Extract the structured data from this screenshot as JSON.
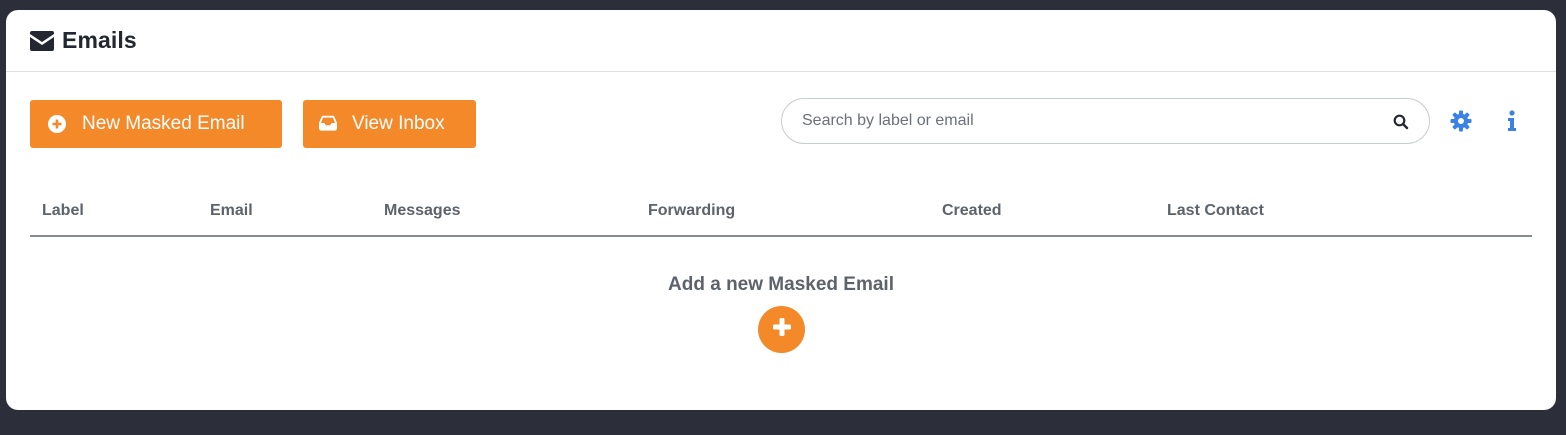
{
  "header": {
    "icon": "envelope-icon",
    "title": "Emails"
  },
  "toolbar": {
    "new_masked_email_label": "New Masked Email",
    "new_masked_email_icon": "plus-circle-icon",
    "view_inbox_label": "View Inbox",
    "view_inbox_icon": "inbox-icon",
    "search": {
      "placeholder": "Search by label or email",
      "value": "",
      "icon": "search-icon"
    },
    "settings_icon": "gear-icon",
    "info_icon": "info-icon"
  },
  "table": {
    "columns": [
      "Label",
      "Email",
      "Messages",
      "Forwarding",
      "Created",
      "Last Contact"
    ],
    "rows": []
  },
  "empty_state": {
    "text": "Add a new Masked Email",
    "icon": "plus-icon"
  },
  "colors": {
    "accent": "#f4892a",
    "icon_blue": "#3b82e6",
    "background": "#2c2f3a",
    "card": "#ffffff",
    "heading_text": "#222731",
    "muted_text": "#5d626b"
  }
}
